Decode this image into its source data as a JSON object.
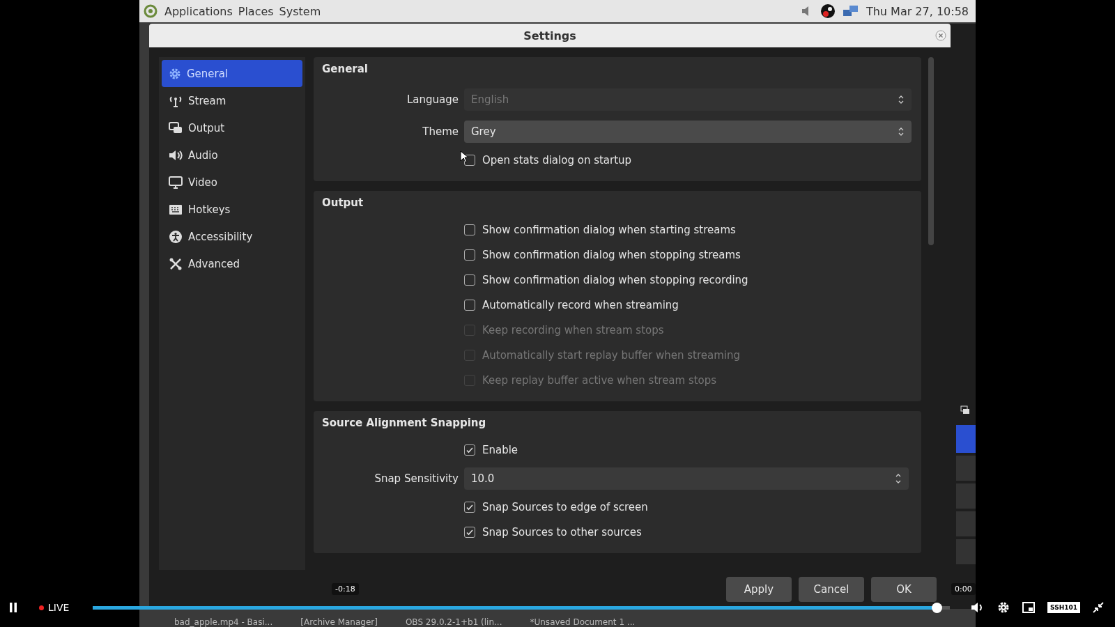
{
  "top_panel": {
    "menus": [
      "Applications",
      "Places",
      "System"
    ],
    "clock": "Thu Mar 27, 10:58"
  },
  "dialog": {
    "title": "Settings",
    "sidebar": [
      {
        "label": "General",
        "selected": true
      },
      {
        "label": "Stream",
        "selected": false
      },
      {
        "label": "Output",
        "selected": false
      },
      {
        "label": "Audio",
        "selected": false
      },
      {
        "label": "Video",
        "selected": false
      },
      {
        "label": "Hotkeys",
        "selected": false
      },
      {
        "label": "Accessibility",
        "selected": false
      },
      {
        "label": "Advanced",
        "selected": false
      }
    ],
    "sections": [
      {
        "title": "General",
        "rows": [
          {
            "kind": "combo",
            "label": "Language",
            "value": "English",
            "disabled": true
          },
          {
            "kind": "combo",
            "label": "Theme",
            "value": "Grey",
            "disabled": false
          },
          {
            "kind": "checkbox",
            "label": "Open stats dialog on startup",
            "checked": false,
            "disabled": false
          }
        ]
      },
      {
        "title": "Output",
        "rows": [
          {
            "kind": "checkbox",
            "label": "Show confirmation dialog when starting streams",
            "checked": false,
            "disabled": false
          },
          {
            "kind": "checkbox",
            "label": "Show confirmation dialog when stopping streams",
            "checked": false,
            "disabled": false
          },
          {
            "kind": "checkbox",
            "label": "Show confirmation dialog when stopping recording",
            "checked": false,
            "disabled": false
          },
          {
            "kind": "checkbox",
            "label": "Automatically record when streaming",
            "checked": false,
            "disabled": false
          },
          {
            "kind": "checkbox",
            "label": "Keep recording when stream stops",
            "checked": false,
            "disabled": true
          },
          {
            "kind": "checkbox",
            "label": "Automatically start replay buffer when streaming",
            "checked": false,
            "disabled": true
          },
          {
            "kind": "checkbox",
            "label": "Keep replay buffer active when stream stops",
            "checked": false,
            "disabled": true
          }
        ]
      },
      {
        "title": "Source Alignment Snapping",
        "rows": [
          {
            "kind": "checkbox",
            "label": "Enable",
            "checked": true,
            "disabled": false
          },
          {
            "kind": "spin",
            "label": "Snap Sensitivity",
            "value": "10.0",
            "disabled": false
          },
          {
            "kind": "checkbox",
            "label": "Snap Sources to edge of screen",
            "checked": true,
            "disabled": false
          },
          {
            "kind": "checkbox",
            "label": "Snap Sources to other sources",
            "checked": true,
            "disabled": false
          }
        ]
      }
    ],
    "buttons": [
      "Apply",
      "Cancel",
      "OK"
    ]
  },
  "taskbar": [
    "bad_apple.mp4 - Basi...",
    "[Archive Manager]",
    "OBS 29.0.2-1+b1 (lin...",
    "*Unsaved Document 1 ..."
  ],
  "player": {
    "live": "LIVE",
    "level": 0.985,
    "seek_tooltip": "-0:18",
    "end_time": "0:00",
    "logo": "SSH101"
  }
}
